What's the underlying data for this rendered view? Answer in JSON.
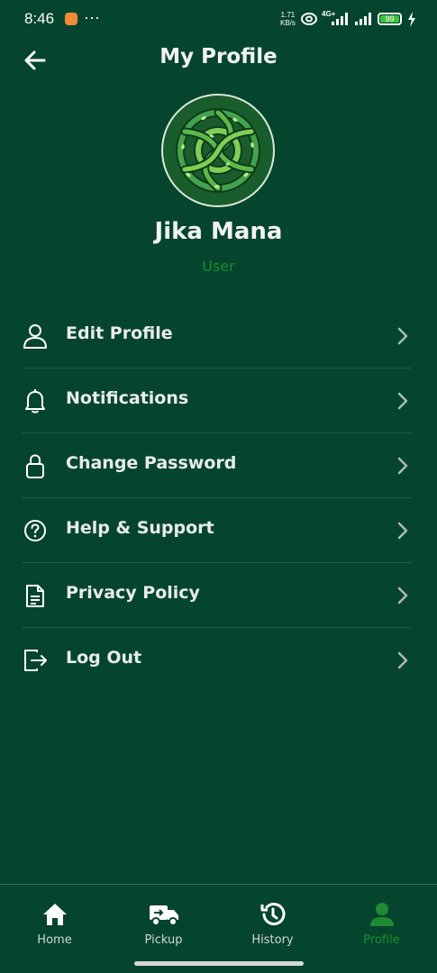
{
  "status_bar": {
    "time": "8:46",
    "dots": "···",
    "net_speed_top": "1.71",
    "net_speed_bottom": "KB/s",
    "network": "4G+",
    "battery": "99"
  },
  "header": {
    "title": "My Profile"
  },
  "profile": {
    "name": "Jika Mana",
    "role": "User"
  },
  "menu": {
    "items": [
      {
        "label": "Edit Profile",
        "icon": "user-icon"
      },
      {
        "label": "Notifications",
        "icon": "bell-icon"
      },
      {
        "label": "Change Password",
        "icon": "lock-icon"
      },
      {
        "label": "Help & Support",
        "icon": "help-icon"
      },
      {
        "label": "Privacy Policy",
        "icon": "document-icon"
      },
      {
        "label": "Log Out",
        "icon": "logout-icon"
      }
    ]
  },
  "bottom_nav": {
    "items": [
      {
        "label": "Home",
        "icon": "home-icon"
      },
      {
        "label": "Pickup",
        "icon": "truck-icon"
      },
      {
        "label": "History",
        "icon": "history-icon"
      },
      {
        "label": "Profile",
        "icon": "profile-icon",
        "active": true
      }
    ]
  },
  "colors": {
    "background": "#05452D",
    "accent": "#1F8A32",
    "text": "#F2F2F2"
  }
}
